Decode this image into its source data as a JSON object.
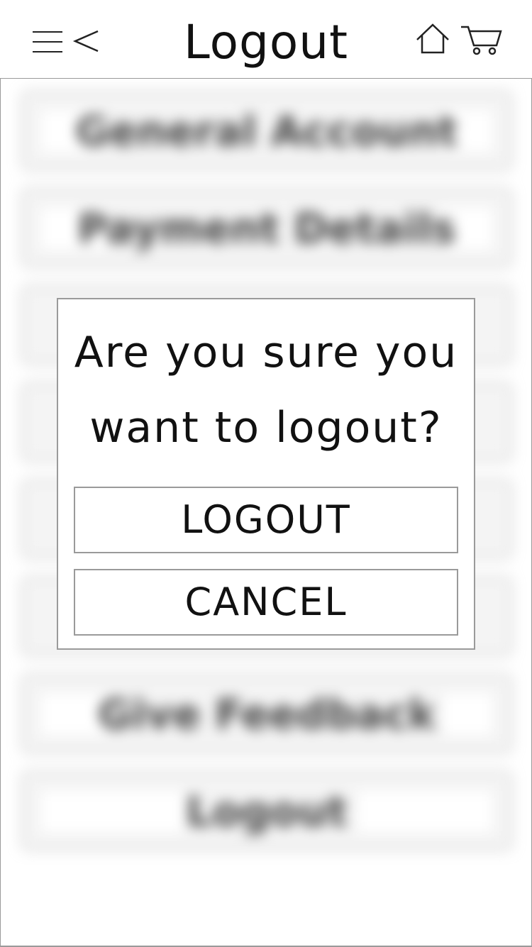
{
  "header": {
    "title": "Logout",
    "icons": {
      "menu": "hamburger-menu-icon",
      "back": "chevron-left-icon",
      "home": "home-icon",
      "cart": "shopping-cart-icon"
    }
  },
  "menu": {
    "items": [
      {
        "label": "General Account"
      },
      {
        "label": "Payment Details"
      },
      {
        "label": ""
      },
      {
        "label": ""
      },
      {
        "label": ""
      },
      {
        "label": ""
      },
      {
        "label": "Give Feedback"
      },
      {
        "label": "Logout"
      }
    ]
  },
  "dialog": {
    "message": "Are you sure you\nwant to logout?",
    "confirm_label": "LOGOUT",
    "cancel_label": "CANCEL"
  },
  "colors": {
    "border": "#9a9a9a",
    "text": "#111111",
    "background": "#ffffff"
  }
}
